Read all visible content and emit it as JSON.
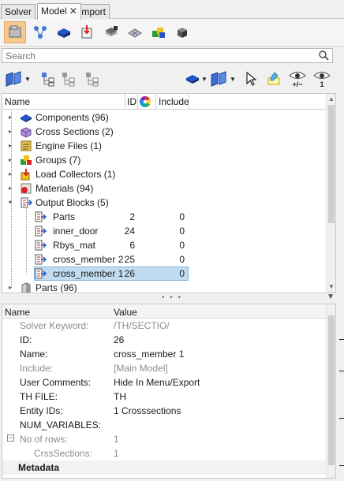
{
  "tabs": [
    {
      "label": "Solver"
    },
    {
      "label": "Model",
      "close": "✕"
    },
    {
      "label": "Import"
    }
  ],
  "search": {
    "placeholder": "Search"
  },
  "tree": {
    "columns": {
      "name": "Name",
      "id": "ID",
      "include": "Include"
    },
    "items": [
      {
        "label": "Components (96)"
      },
      {
        "label": "Cross Sections (2)"
      },
      {
        "label": "Engine Files (1)"
      },
      {
        "label": "Groups (7)"
      },
      {
        "label": "Load Collectors (1)"
      },
      {
        "label": "Materials (94)"
      },
      {
        "label": "Output Blocks (5)"
      },
      {
        "label": "Parts",
        "id": "2",
        "include": "0"
      },
      {
        "label": "inner_door",
        "id": "24",
        "include": "0"
      },
      {
        "label": "Rbys_mat",
        "id": "6",
        "include": "0"
      },
      {
        "label": "cross_member 2",
        "id": "25",
        "include": "0"
      },
      {
        "label": "cross_member 1",
        "id": "26",
        "include": "0"
      },
      {
        "label": "Parts (96)"
      }
    ]
  },
  "properties": {
    "columns": {
      "name": "Name",
      "value": "Value"
    },
    "rows": [
      {
        "name": "Solver Keyword:",
        "value": "/TH/SECTIO/"
      },
      {
        "name": "ID:",
        "value": "26"
      },
      {
        "name": "Name:",
        "value": "cross_member 1"
      },
      {
        "name": "Include:",
        "value": "[Main Model]"
      },
      {
        "name": "User Comments:",
        "value": "Hide In Menu/Export"
      },
      {
        "name": "TH FILE:",
        "value": "TH"
      },
      {
        "name": "Entity IDs:",
        "value": "1 Crosssections"
      },
      {
        "name": "NUM_VARIABLES:",
        "value": ""
      },
      {
        "name": "No of rows:",
        "value": "1"
      },
      {
        "name": "CrssSections:",
        "value": "1"
      },
      {
        "name": "Metadata",
        "value": ""
      }
    ]
  },
  "view_toolbar": {
    "hide_label": "+/−",
    "show_label": "1"
  },
  "colors": {
    "selection": "#c1dcf0",
    "active_tool": "#f6c78f"
  }
}
